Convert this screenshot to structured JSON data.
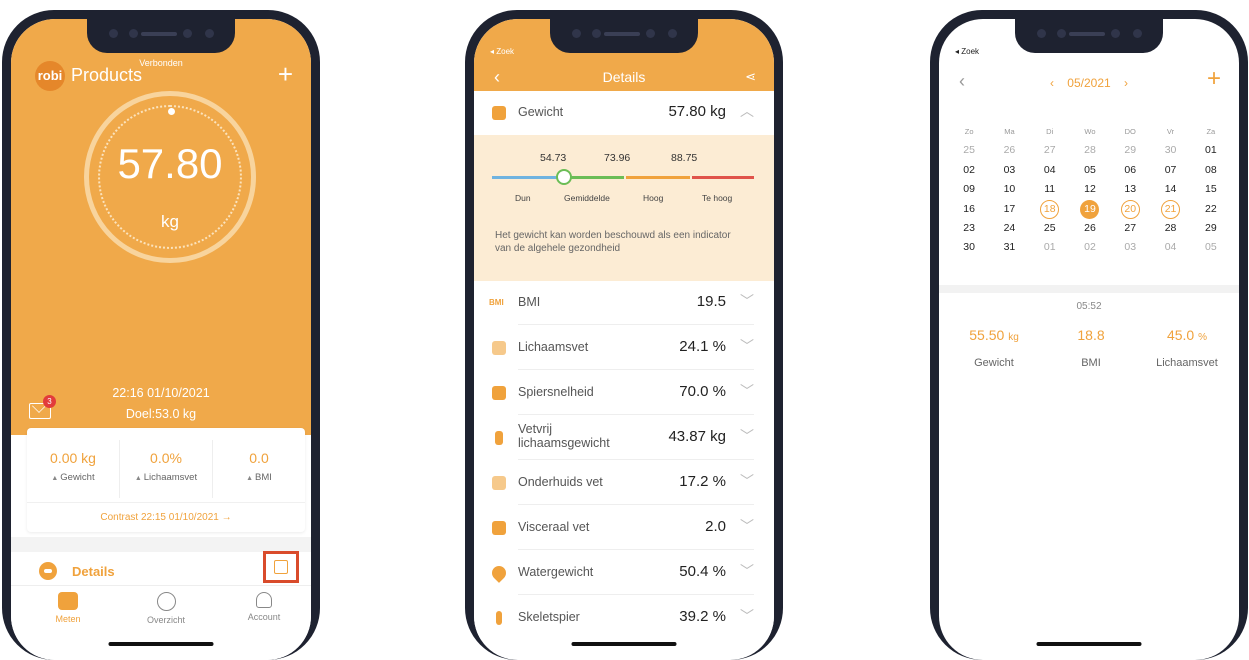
{
  "phone1": {
    "status": "Verbonden",
    "logo": "robi",
    "title": "Products",
    "add": "+",
    "weight": "57.80",
    "unit": "kg",
    "datetime": "22:16 01/10/2021",
    "goal": "Doel:53.0 kg",
    "mail_badge": "3",
    "deltas": [
      {
        "value": "0.00 kg",
        "label": "Gewicht"
      },
      {
        "value": "0.0%",
        "label": "Lichaamsvet"
      },
      {
        "value": "0.0",
        "label": "BMI"
      }
    ],
    "contrast": "Contrast 22:15 01/10/2021 →",
    "details": "Details",
    "tabs": [
      {
        "label": "Meten",
        "icon": "scale-icon"
      },
      {
        "label": "Overzicht",
        "icon": "chart-icon"
      },
      {
        "label": "Account",
        "icon": "person-icon"
      }
    ],
    "accent": "#f0a23c"
  },
  "phone2": {
    "back_label": "◂ Zoek",
    "title": "Details",
    "weight_label": "Gewicht",
    "weight_value": "57.80 kg",
    "thresholds": [
      "54.73",
      "73.96",
      "88.75"
    ],
    "bands": [
      {
        "label": "Dun",
        "color": "#6fb3e0"
      },
      {
        "label": "Gemiddelde",
        "color": "#6bbd56"
      },
      {
        "label": "Hoog",
        "color": "#f0a23c"
      },
      {
        "label": "Te hoog",
        "color": "#e0534a"
      }
    ],
    "description": "Het gewicht kan worden beschouwd als een indicator van de algehele gezondheid",
    "metrics": [
      {
        "label": "BMI",
        "value": "19.5",
        "icon": "bmi-icon",
        "icon_text": "BMI"
      },
      {
        "label": "Lichaamsvet",
        "value": "24.1 %",
        "icon": "body-fat-icon"
      },
      {
        "label": "Spiersnelheid",
        "value": "70.0 %",
        "icon": "muscle-icon"
      },
      {
        "label": "Vetvrij lichaamsgewicht",
        "value": "43.87 kg",
        "icon": "lean-mass-icon"
      },
      {
        "label": "Onderhuids vet",
        "value": "17.2 %",
        "icon": "subcutaneous-fat-icon"
      },
      {
        "label": "Visceraal vet",
        "value": "2.0",
        "icon": "visceral-fat-icon"
      },
      {
        "label": "Watergewicht",
        "value": "50.4 %",
        "icon": "water-drop-icon"
      },
      {
        "label": "Skeletspier",
        "value": "39.2 %",
        "icon": "skeletal-muscle-icon"
      }
    ]
  },
  "phone3": {
    "back_label": "◂ Zoek",
    "month": "05/2021",
    "weekdays": [
      "Zo",
      "Ma",
      "Di",
      "Wo",
      "DO",
      "Vr",
      "Za"
    ],
    "weeks": [
      [
        "25",
        "26",
        "27",
        "28",
        "29",
        "30",
        "01"
      ],
      [
        "02",
        "03",
        "04",
        "05",
        "06",
        "07",
        "08"
      ],
      [
        "09",
        "10",
        "11",
        "12",
        "13",
        "14",
        "15"
      ],
      [
        "16",
        "17",
        "18",
        "19",
        "20",
        "21",
        "22"
      ],
      [
        "23",
        "24",
        "25",
        "26",
        "27",
        "28",
        "29"
      ],
      [
        "30",
        "31",
        "01",
        "02",
        "03",
        "04",
        "05"
      ]
    ],
    "marked_days": [
      "18",
      "20",
      "21"
    ],
    "selected_day": "19",
    "time": "05:52",
    "summary": [
      {
        "value": "55.50",
        "unit": "kg",
        "label": "Gewicht"
      },
      {
        "value": "18.8",
        "unit": "",
        "label": "BMI"
      },
      {
        "value": "45.0",
        "unit": "%",
        "label": "Lichaamsvet"
      }
    ]
  }
}
